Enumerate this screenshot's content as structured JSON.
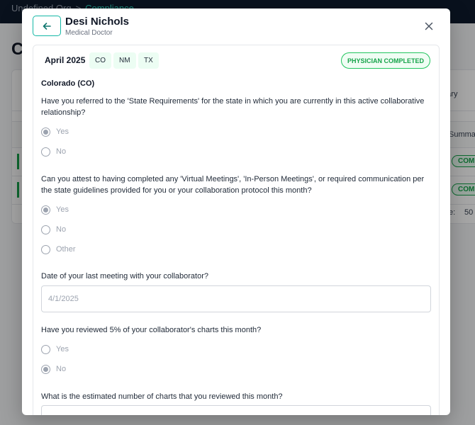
{
  "background": {
    "breadcrumb": {
      "org": "Undefined Org",
      "separator": ">",
      "current": "Compliance"
    },
    "page_title": "C",
    "filter_label": "mary",
    "column_header": "Summar",
    "rows": [
      {
        "status": "COMPLE"
      },
      {
        "status": "COMPLE"
      }
    ],
    "page_size_label": "e:",
    "page_size_value": "50"
  },
  "modal": {
    "back_icon": "arrow-left-icon",
    "close_icon": "close-icon",
    "doctor": {
      "name": "Desi Nichols",
      "role": "Medical Doctor"
    },
    "month": "April 2025",
    "states": [
      "CO",
      "NM",
      "TX"
    ],
    "status_badge": "PHYSICIAN COMPLETED",
    "section_title": "Colorado (CO)",
    "questions": {
      "q1": {
        "text": "Have you referred to the 'State Requirements' for the state in which you are currently in this active collaborative relationship?",
        "options": [
          {
            "label": "Yes",
            "selected": true
          },
          {
            "label": "No",
            "selected": false
          }
        ]
      },
      "q2": {
        "text": "Can you attest to having completed any 'Virtual Meetings', 'In-Person Meetings', or required communication per the state guidelines provided for you or your collaboration protocol this month?",
        "options": [
          {
            "label": "Yes",
            "selected": true
          },
          {
            "label": "No",
            "selected": false
          },
          {
            "label": "Other",
            "selected": false
          }
        ]
      },
      "q3": {
        "text": "Date of your last meeting with your collaborator?",
        "value": "4/1/2025"
      },
      "q4": {
        "text": "Have you reviewed 5% of your collaborator's charts this month?",
        "options": [
          {
            "label": "Yes",
            "selected": false
          },
          {
            "label": "No",
            "selected": true
          }
        ]
      },
      "q5": {
        "text": "What is the estimated number of charts that you reviewed this month?",
        "value": ""
      }
    },
    "colors": {
      "accent": "#14b8a6",
      "success": "#16a34a",
      "tag_bg": "#ecfdf3"
    }
  }
}
